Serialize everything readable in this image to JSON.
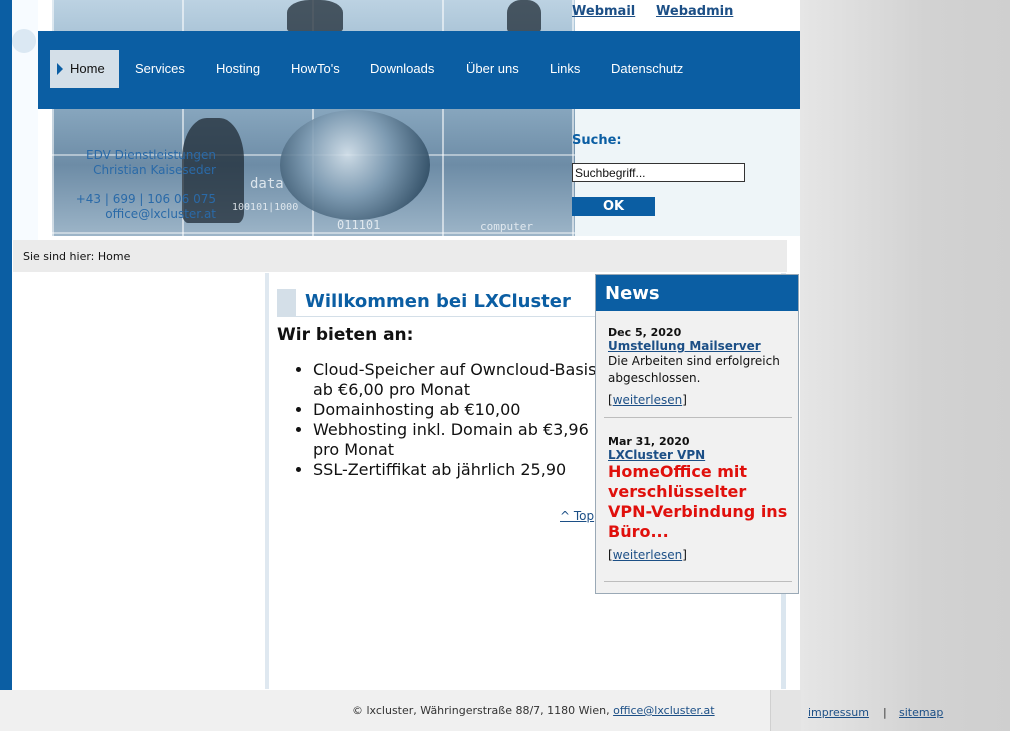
{
  "top_links": {
    "webmail": "Webmail",
    "webadmin": "Webadmin"
  },
  "nav": {
    "items": [
      "Home",
      "Services",
      "Hosting",
      "HowTo's",
      "Downloads",
      "Über uns",
      "Links",
      "Datenschutz"
    ],
    "active": "Home"
  },
  "contact": {
    "line1": "EDV Dienstleistungen",
    "line2": "Christian Kaiseseder",
    "phone": "+43 | 699 | 106 06 075",
    "email": "office@lxcluster.at"
  },
  "search": {
    "label": "Suche:",
    "value": "Suchbegriff...",
    "button": "OK"
  },
  "breadcrumb": "Sie sind hier: Home",
  "main": {
    "title": "Willkommen bei LXCluster",
    "offer_title": "Wir bieten an:",
    "offers": [
      "Cloud-Speicher auf Owncloud-Basis ab €6,00 pro Monat",
      "Domainhosting ab €10,00",
      "Webhosting inkl. Domain ab €3,96 pro Monat",
      "SSL-Zertiffikat ab jährlich 25,90"
    ],
    "top_link": "^ Top"
  },
  "news": {
    "heading": "News",
    "items": [
      {
        "date": "Dec 5, 2020",
        "title": "Umstellung Mailserver",
        "text": "Die Arbeiten sind erfolgreich abgeschlossen.",
        "more": "weiterlesen"
      },
      {
        "date": "Mar 31, 2020",
        "title": "LXCluster VPN",
        "text": "HomeOffice mit verschlüsselter VPN-Verbindung ins Büro...",
        "more": "weiterlesen"
      }
    ]
  },
  "footer": {
    "address": "© lxcluster, Währingerstraße 88/7, 1180 Wien, ",
    "email": "office@lxcluster.at",
    "impressum": "impressum",
    "sitemap": "sitemap",
    "separator": "|"
  },
  "header_image_words": {
    "data": "data",
    "binary": "100101|1000",
    "computer": "computer",
    "binary2": "011101"
  },
  "colors": {
    "primary": "#0b5ea3",
    "link": "#1c4f86",
    "alert": "#e0100c"
  }
}
